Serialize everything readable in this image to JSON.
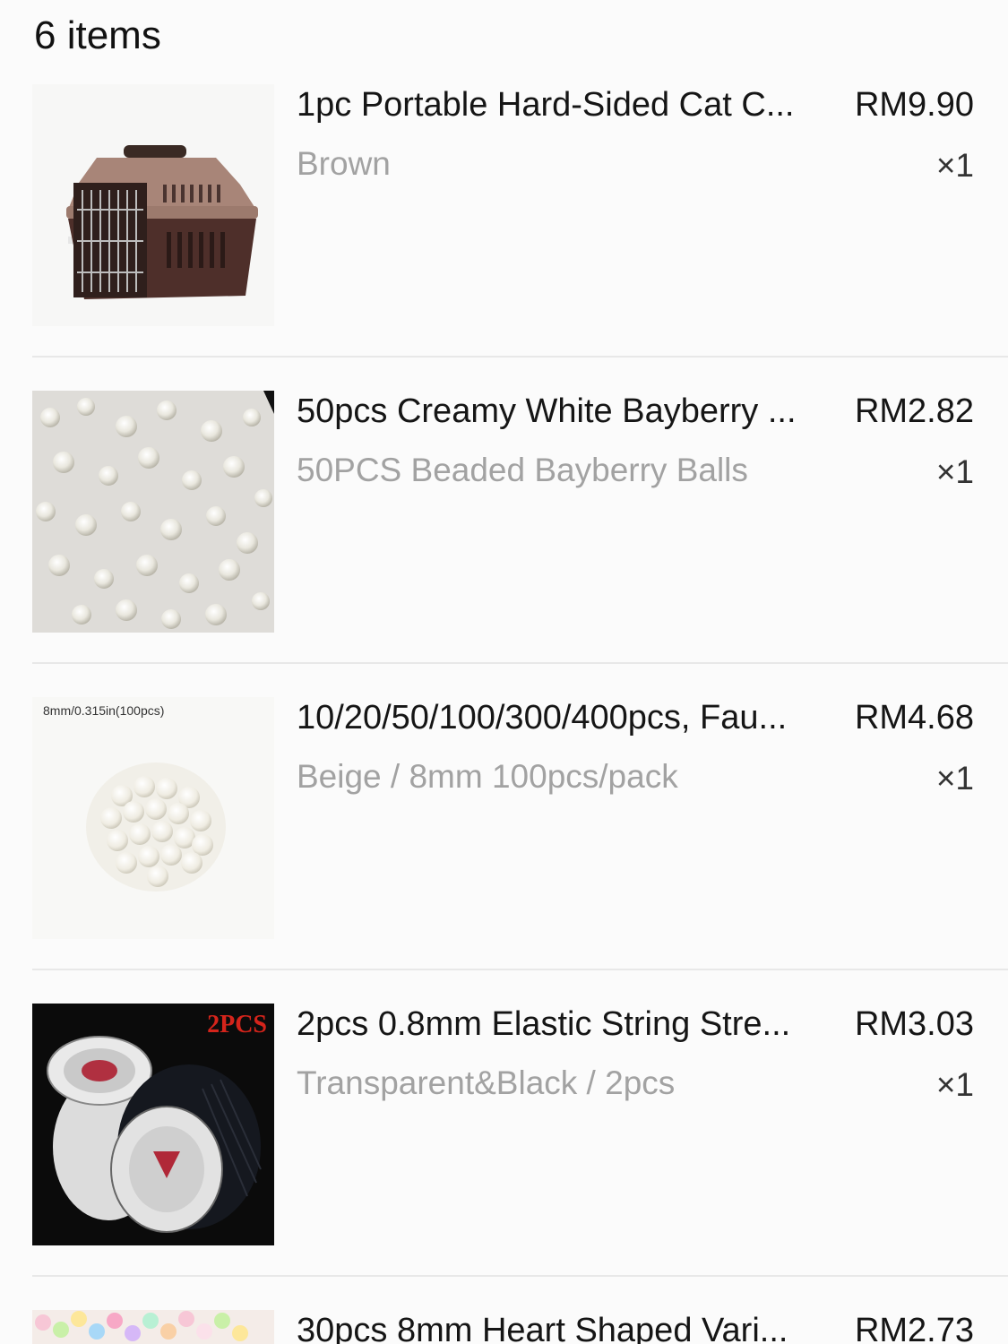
{
  "header": {
    "count_label": "6 items"
  },
  "items": [
    {
      "title": "1pc Portable Hard-Sided Cat C...",
      "variant": "Brown",
      "price": "RM9.90",
      "quantity": "×1",
      "image": "pet-carrier-image"
    },
    {
      "title": "50pcs Creamy White Bayberry ...",
      "variant": "50PCS Beaded Bayberry Balls",
      "price": "RM2.82",
      "quantity": "×1",
      "image": "pearl-beads-image"
    },
    {
      "title": "10/20/50/100/300/400pcs, Fau...",
      "variant": "Beige / 8mm 100pcs/pack",
      "price": "RM4.68",
      "quantity": "×1",
      "image": "faux-pearls-image",
      "image_caption": "8mm/0.315in(100pcs)"
    },
    {
      "title": "2pcs 0.8mm Elastic String Stre...",
      "variant": "Transparent&Black / 2pcs",
      "price": "RM3.03",
      "quantity": "×1",
      "image": "elastic-string-image",
      "image_badge": "2PCS"
    },
    {
      "title": "30pcs 8mm Heart Shaped Vari...",
      "variant": "",
      "price": "RM2.73",
      "quantity": "",
      "image": "heart-beads-image"
    }
  ]
}
